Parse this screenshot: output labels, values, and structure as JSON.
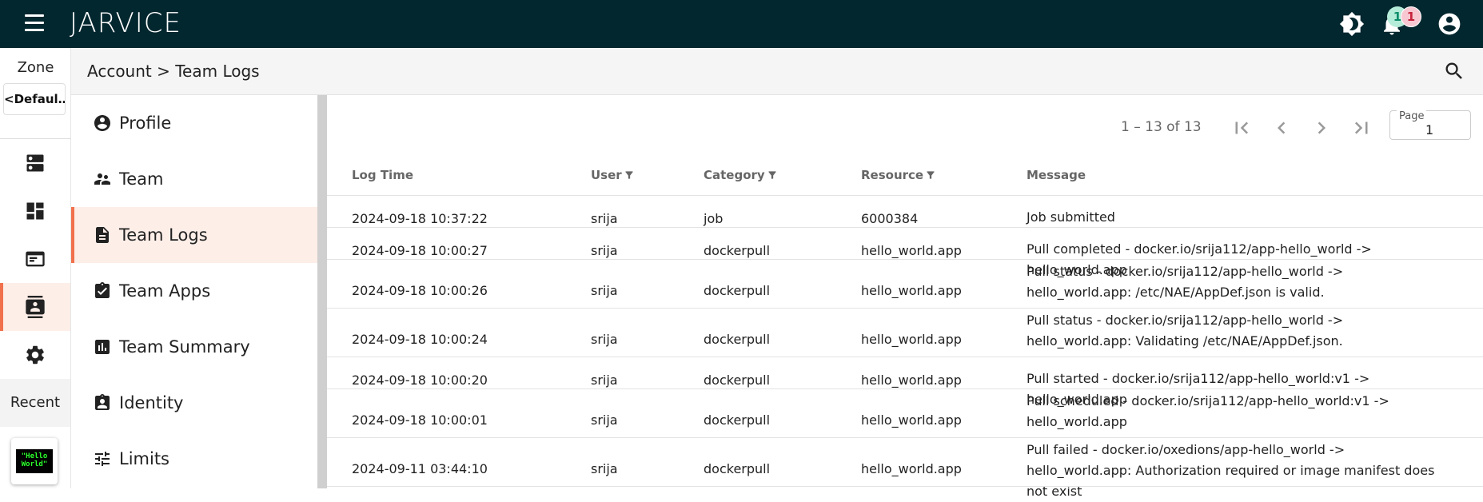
{
  "header": {
    "brand": "JARVICE",
    "notifications": {
      "green_count": "1",
      "pink_count": "1"
    },
    "colors": {
      "topbar": "#03272f",
      "accent": "#f0714c"
    },
    "icons": [
      "menu-icon",
      "brightness-icon",
      "bell-icon",
      "account-circle-icon"
    ]
  },
  "rail": {
    "zone_label": "Zone",
    "zone_value": "<Defaul…",
    "items": [
      {
        "name": "rail-item-compute",
        "icon": "server-icon",
        "active": false
      },
      {
        "name": "rail-item-dashboard",
        "icon": "dashboard-icon",
        "active": false
      },
      {
        "name": "rail-item-jobs",
        "icon": "terminal-icon",
        "active": false
      },
      {
        "name": "rail-item-account",
        "icon": "contact-icon",
        "active": true
      },
      {
        "name": "rail-item-settings",
        "icon": "gear-icon",
        "active": false
      }
    ],
    "recent_label": "Recent",
    "recent_app_text": "\"Hello World\""
  },
  "breadcrumb": "Account > Team Logs",
  "account_menu": [
    {
      "label": "Profile",
      "icon": "account-circle-icon",
      "active": false
    },
    {
      "label": "Team",
      "icon": "people-icon",
      "active": false
    },
    {
      "label": "Team Logs",
      "icon": "document-icon",
      "active": true
    },
    {
      "label": "Team Apps",
      "icon": "clipboard-check-icon",
      "active": false
    },
    {
      "label": "Team Summary",
      "icon": "bar-chart-icon",
      "active": false
    },
    {
      "label": "Identity",
      "icon": "badge-icon",
      "active": false
    },
    {
      "label": "Limits",
      "icon": "tune-icon",
      "active": false
    }
  ],
  "pagination": {
    "range": "1 – 13 of 13",
    "page_label": "Page",
    "page_value": "1"
  },
  "table": {
    "columns": [
      "Log Time",
      "User",
      "Category",
      "Resource",
      "Message"
    ],
    "rows": [
      {
        "time": "2024-09-18 10:37:22",
        "user": "srija",
        "category": "job",
        "resource": "6000384",
        "message": "Job submitted"
      },
      {
        "time": "2024-09-18 10:00:27",
        "user": "srija",
        "category": "dockerpull",
        "resource": "hello_world.app",
        "message": "Pull completed - docker.io/srija112/app-hello_world -> hello_world.app"
      },
      {
        "time": "2024-09-18 10:00:26",
        "user": "srija",
        "category": "dockerpull",
        "resource": "hello_world.app",
        "message": "Pull status - docker.io/srija112/app-hello_world -> hello_world.app: /etc/NAE/AppDef.json is valid."
      },
      {
        "time": "2024-09-18 10:00:24",
        "user": "srija",
        "category": "dockerpull",
        "resource": "hello_world.app",
        "message": "Pull status - docker.io/srija112/app-hello_world -> hello_world.app: Validating /etc/NAE/AppDef.json."
      },
      {
        "time": "2024-09-18 10:00:20",
        "user": "srija",
        "category": "dockerpull",
        "resource": "hello_world.app",
        "message": "Pull started - docker.io/srija112/app-hello_world:v1 -> hello_world.app"
      },
      {
        "time": "2024-09-18 10:00:01",
        "user": "srija",
        "category": "dockerpull",
        "resource": "hello_world.app",
        "message": "Pull scheduled - docker.io/srija112/app-hello_world:v1 -> hello_world.app"
      },
      {
        "time": "2024-09-11 03:44:10",
        "user": "srija",
        "category": "dockerpull",
        "resource": "hello_world.app",
        "message": "Pull failed - docker.io/oxedions/app-hello_world -> hello_world.app: Authorization required or image manifest does not exist"
      }
    ]
  }
}
